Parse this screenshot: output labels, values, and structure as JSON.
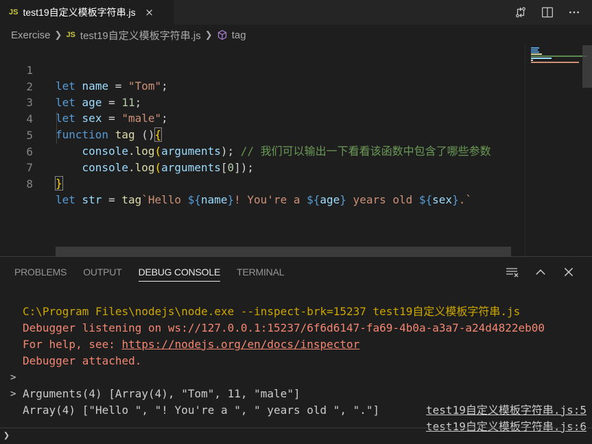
{
  "tab": {
    "badge": "JS",
    "title": "test19自定义模板字符串.js",
    "close": "×"
  },
  "breadcrumbs": {
    "folder": "Exercise",
    "file_badge": "JS",
    "file": "test19自定义模板字符串.js",
    "symbol": "tag"
  },
  "editor": {
    "line_numbers": [
      "1",
      "2",
      "3",
      "4",
      "5",
      "6",
      "7",
      "8"
    ],
    "lines": {
      "l1": {
        "kw": "let",
        "name": "name",
        "eq": " = ",
        "str": "\"Tom\"",
        "semi": ";"
      },
      "l2": {
        "kw": "let",
        "name": "age",
        "eq": " = ",
        "num": "11",
        "semi": ";"
      },
      "l3": {
        "kw": "let",
        "name": "sex",
        "eq": " = ",
        "str": "\"male\"",
        "semi": ";"
      },
      "l4": {
        "kw": "function",
        "fn": "tag",
        "parens": " ()",
        "brace": "{"
      },
      "l5": {
        "obj": "console",
        "dot": ".",
        "fn": "log",
        "open": "(",
        "arg": "arguments",
        "close": ");",
        "comment": "// 我们可以输出一下看看该函数中包含了哪些参数"
      },
      "l6": {
        "obj": "console",
        "dot": ".",
        "fn": "log",
        "open": "(",
        "arg": "arguments",
        "idx_open": "[",
        "idx": "0",
        "idx_close": "]",
        "close": ");"
      },
      "l7": {
        "brace": "}"
      },
      "l8": {
        "kw": "let",
        "name": "str",
        "eq": " = ",
        "fn": "tag",
        "s1": "`Hello ",
        "i1o": "${",
        "i1": "name",
        "i1c": "}",
        "s2": "! You're a ",
        "i2o": "${",
        "i2": "age",
        "i2c": "}",
        "s3": " years old ",
        "i3o": "${",
        "i3": "sex",
        "i3c": "}",
        "s4": ".`"
      }
    }
  },
  "panel": {
    "tabs": [
      "PROBLEMS",
      "OUTPUT",
      "DEBUG CONSOLE",
      "TERMINAL"
    ],
    "active_tab": "DEBUG CONSOLE"
  },
  "console": {
    "cmd": "C:\\Program Files\\nodejs\\node.exe --inspect-brk=15237 test19自定义模板字符串.js",
    "listening": "Debugger listening on ws://127.0.0.1:15237/6f6d6147-fa69-4b0a-a3a7-a24d4822eb00",
    "help_prefix": "For help, see: ",
    "help_link": "https://nodejs.org/en/docs/inspector",
    "attached": "Debugger attached.",
    "out1": "Arguments(4) [Array(4), \"Tom\", 11, \"male\"]",
    "out1_src": "test19自定义模板字符串.js:5",
    "out2": "Array(4) [\"Hello \", \"! You're a \", \" years old \", \".\"]",
    "out2_src": "test19自定义模板字符串.js:6",
    "caret": ">",
    "input_caret": "❯"
  },
  "colors": {
    "accent_yellow": "#cbcb41",
    "keyword": "#569cd6",
    "string": "#ce9178",
    "warning": "#cca700",
    "error": "#f48771"
  }
}
